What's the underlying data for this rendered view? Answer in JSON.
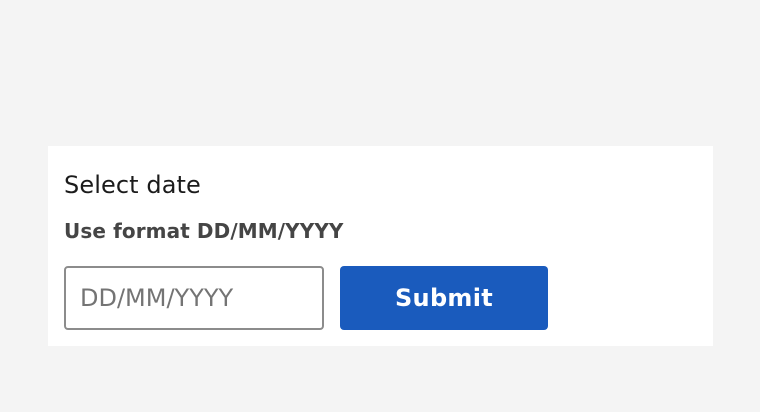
{
  "form": {
    "label": "Select date",
    "hint": "Use format DD/MM/YYYY",
    "input": {
      "placeholder": "DD/MM/YYYY",
      "value": ""
    },
    "submit_label": "Submit"
  },
  "colors": {
    "page_background": "#f4f4f4",
    "card_background": "#ffffff",
    "button_background": "#1a5bbd",
    "button_text": "#ffffff",
    "input_border": "#8c8c8c",
    "label_text": "#1b1b1b",
    "hint_text": "#454545",
    "placeholder_text": "#747474"
  }
}
